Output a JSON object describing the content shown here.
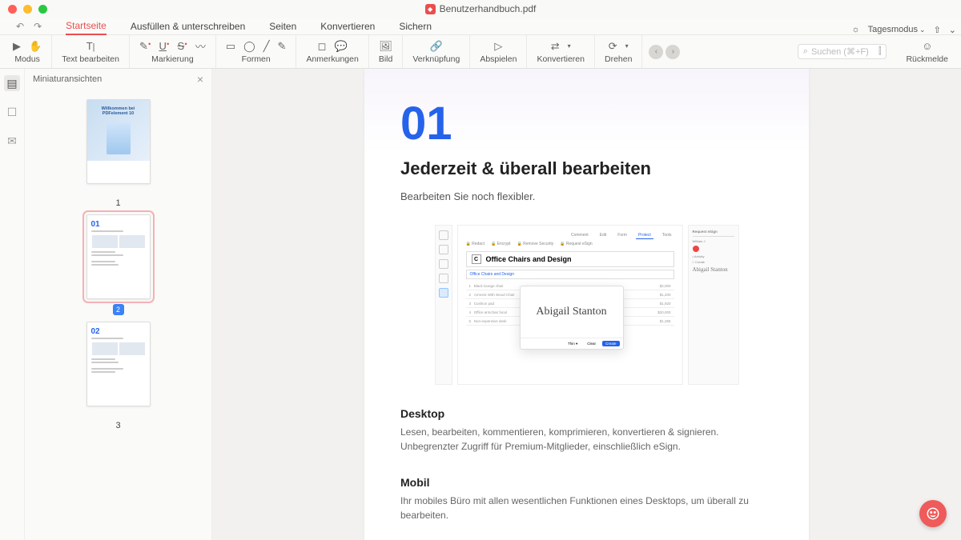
{
  "window": {
    "title": "Benutzerhandbuch.pdf"
  },
  "tabs": {
    "home": "Startseite",
    "fill": "Ausfüllen & unterschreiben",
    "pages": "Seiten",
    "convert": "Konvertieren",
    "protect": "Sichern"
  },
  "top_right": {
    "brightness": "☼",
    "mode": "Tagesmodus"
  },
  "toolbar": {
    "mode": "Modus",
    "edit_text": "Text bearbeiten",
    "highlight": "Markierung",
    "shapes": "Formen",
    "comments": "Anmerkungen",
    "image": "Bild",
    "link": "Verknüpfung",
    "play": "Abspielen",
    "convert": "Konvertieren",
    "rotate": "Drehen",
    "search_placeholder": "Suchen (⌘+F)",
    "feedback": "Rückmelde"
  },
  "sidebar": {
    "title": "Miniaturansichten",
    "pages": [
      "1",
      "2",
      "3"
    ],
    "thumb1_title": "Willkommen bei PDFelement 10"
  },
  "page": {
    "number": "01",
    "heading": "Jederzeit & überall bearbeiten",
    "subtitle": "Bearbeiten Sie noch flexibler.",
    "mock_title": "Office Chairs and Design",
    "signature": "Abigail Stanton",
    "desktop_h": "Desktop",
    "desktop_p": "Lesen, bearbeiten, kommentieren, komprimieren, konvertieren & signieren. Unbegrenzter Zugriff für Premium-Mitglieder, einschließlich eSign.",
    "mobile_h": "Mobil",
    "mobile_p": "Ihr mobiles Büro mit allen wesentlichen Funktionen eines Desktops, um überall zu bearbeiten."
  }
}
